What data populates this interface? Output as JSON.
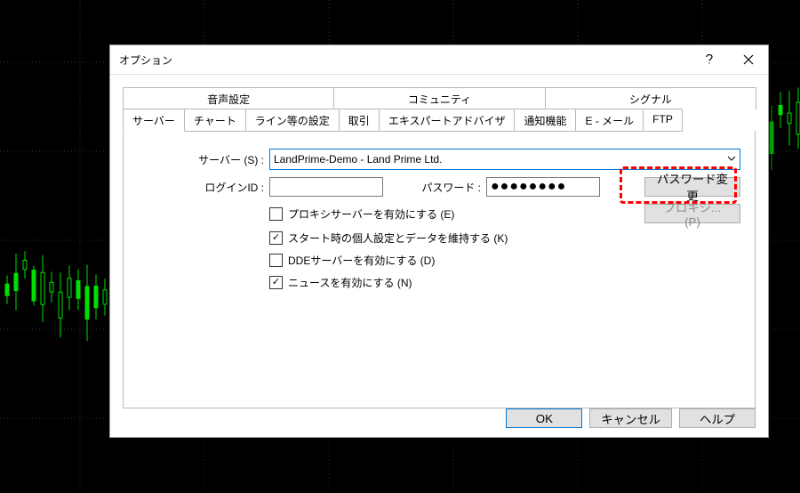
{
  "dialog": {
    "title": "オプション",
    "tabs_top": [
      "音声設定",
      "コミュニティ",
      "シグナル"
    ],
    "tabs_bottom": [
      "サーバー",
      "チャート",
      "ライン等の設定",
      "取引",
      "エキスパートアドバイザ",
      "通知機能",
      "E - メール",
      "FTP"
    ],
    "active_tab": "サーバー"
  },
  "form": {
    "server_label": "サーバー (S) :",
    "server_value": "LandPrime-Demo - Land Prime Ltd.",
    "login_label": "ログインID :",
    "login_value": "",
    "password_label": "パスワード :",
    "password_mask": "●●●●●●●●",
    "change_pw_btn": "パスワード変更",
    "proxy_btn": "プロキシ... (P)",
    "cb_proxy": "プロキシサーバーを有効にする (E)",
    "cb_keep": "スタート時の個人設定とデータを維持する (K)",
    "cb_dde": "DDEサーバーを有効にする (D)",
    "cb_news": "ニュースを有効にする (N)"
  },
  "buttons": {
    "ok": "OK",
    "cancel": "キャンセル",
    "help": "ヘルプ"
  }
}
